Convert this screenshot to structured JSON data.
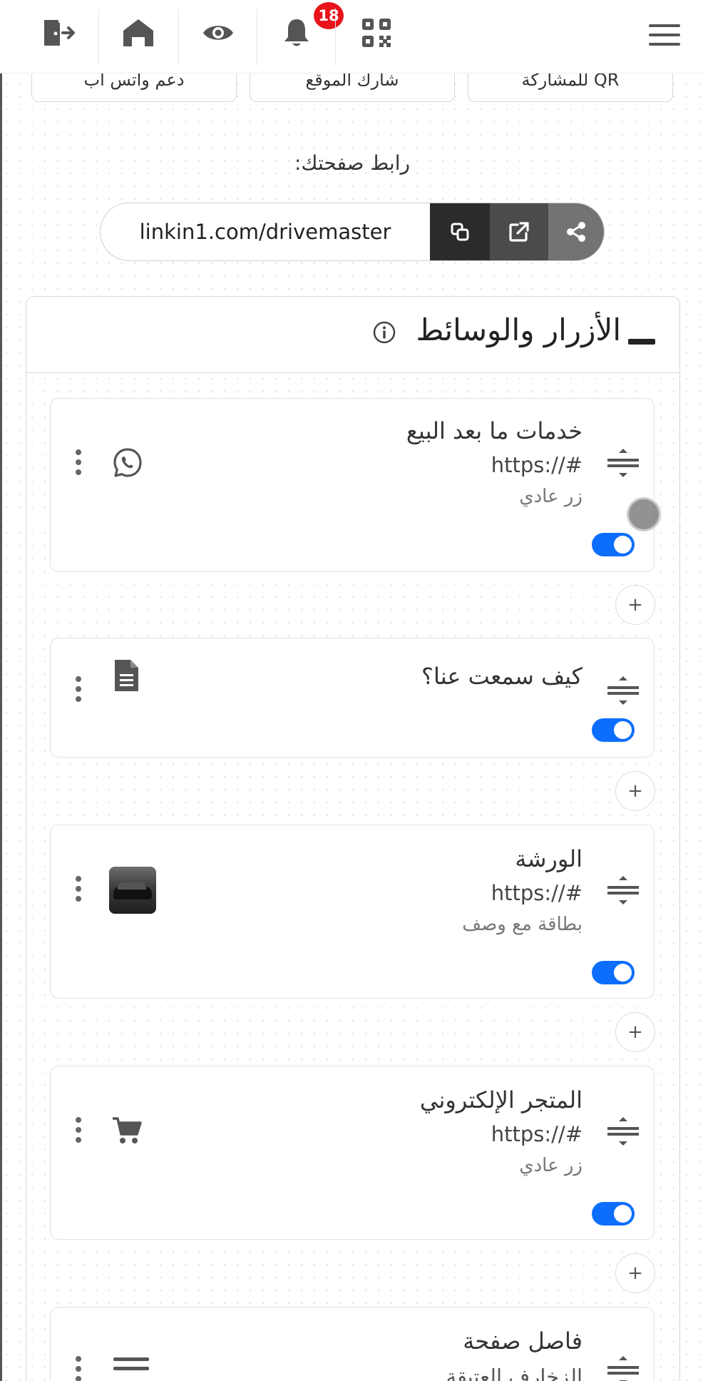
{
  "topbar": {
    "notification_count": "18",
    "icons": [
      "logout-icon",
      "home-icon",
      "eye-icon",
      "bell-icon",
      "qr-code-icon",
      "menu-icon"
    ]
  },
  "shortcuts": [
    {
      "label": "دعم واتس اب"
    },
    {
      "label": "شارك الموقع"
    },
    {
      "label": "QR للمشاركة"
    }
  ],
  "page_link": {
    "label": "رابط صفحتك:",
    "url": "linkin1.com/drivemaster"
  },
  "section": {
    "title": "الأزرار والوسائط"
  },
  "items": [
    {
      "title": "خدمات ما بعد البيع",
      "url": "https://#",
      "type": "زر عادي",
      "icon": "whatsapp-icon",
      "enabled": true
    },
    {
      "title": "كيف سمعت عنا؟",
      "url": "",
      "type": "",
      "icon": "document-icon",
      "enabled": true
    },
    {
      "title": "الورشة",
      "url": "https://#",
      "type": "بطاقة مع وصف",
      "icon": "car-thumbnail",
      "enabled": true
    },
    {
      "title": "المتجر الإلكتروني",
      "url": "https://#",
      "type": "زر عادي",
      "icon": "cart-icon",
      "enabled": true
    },
    {
      "title": "فاصل صفحة",
      "url": "",
      "type": "الزخارف العتيقة",
      "icon": "divider-icon",
      "enabled": true
    }
  ],
  "add_button_label": "+",
  "colors": {
    "accent": "#0d6efd",
    "badge": "#e8141b",
    "icon": "#555555"
  }
}
